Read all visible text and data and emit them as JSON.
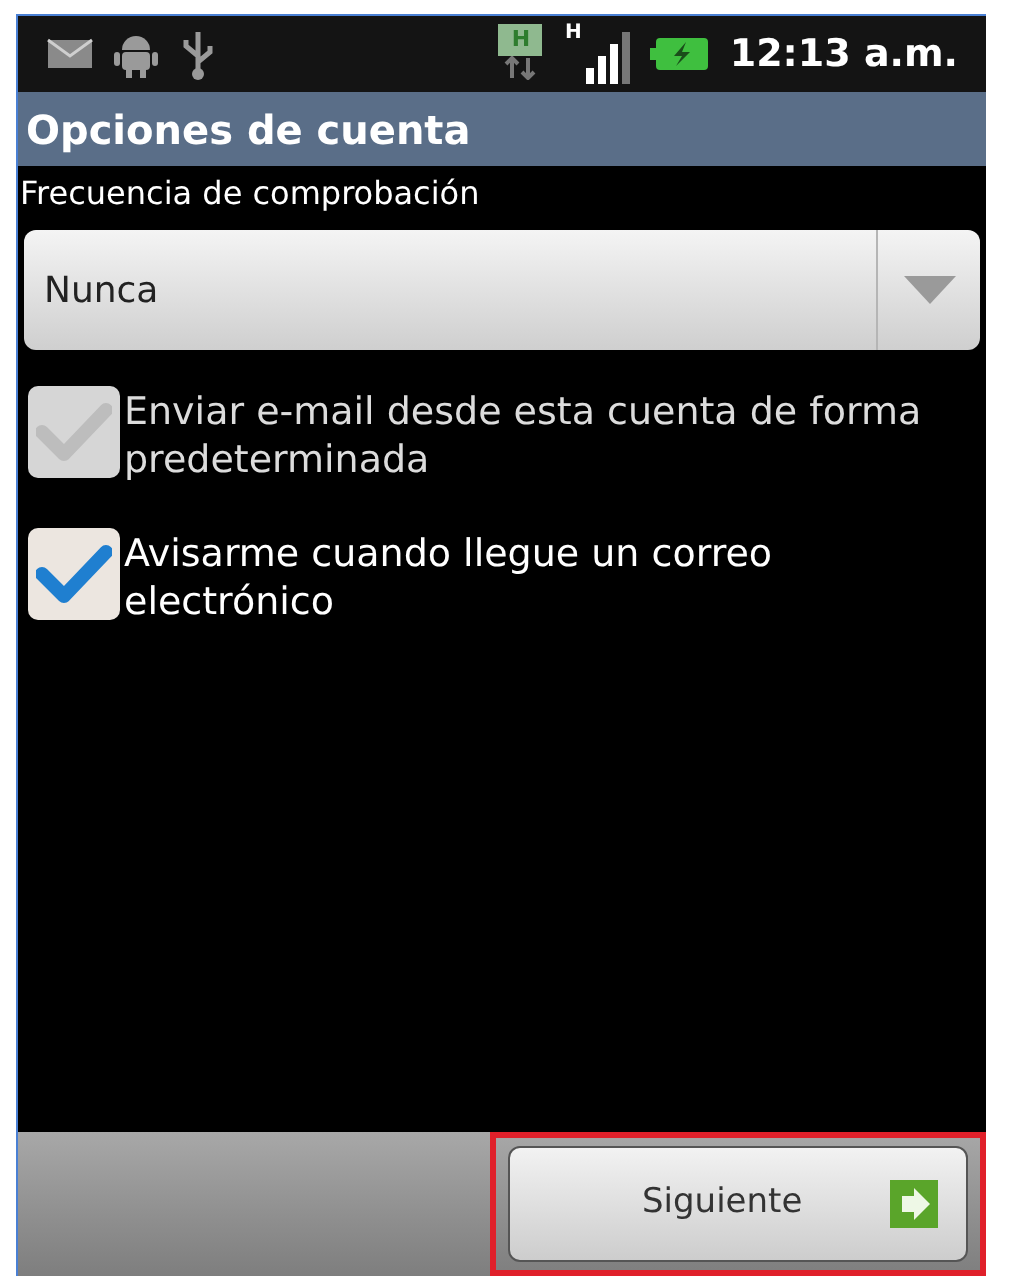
{
  "status_bar": {
    "time": "12:13 a.m.",
    "network_label": "H",
    "signal_label": "H"
  },
  "title_bar": {
    "title": "Opciones de cuenta"
  },
  "check_frequency": {
    "label": "Frecuencia de comprobación",
    "value": "Nunca"
  },
  "options": [
    {
      "label": "Enviar e-mail desde esta cuenta de forma predeterminada",
      "checked": true,
      "disabled": true
    },
    {
      "label": "Avisarme cuando llegue un correo electrónico",
      "checked": true,
      "disabled": false
    }
  ],
  "next_button": {
    "label": "Siguiente",
    "highlighted": true
  }
}
